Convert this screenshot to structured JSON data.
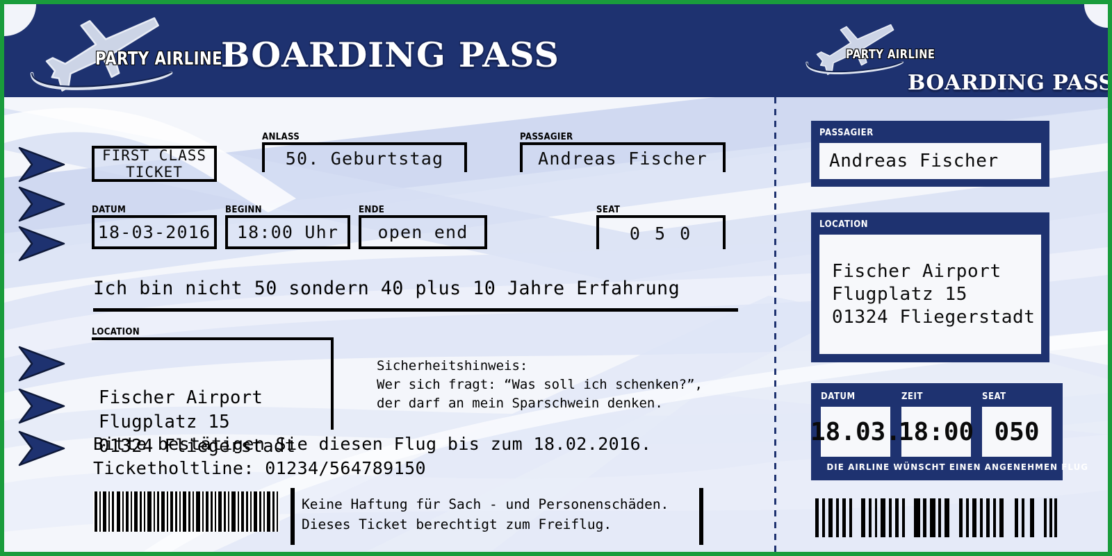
{
  "brand": {
    "airline_name": "PARTY AIRLINE",
    "title": "BOARDING PASS",
    "plane_icon": "airplane-icon",
    "header_color": "#1e3270",
    "border_color": "#1a9c3c"
  },
  "main": {
    "class_box": "FIRST CLASS\nTICKET",
    "anlass": {
      "label": "ANLASS",
      "value": "50. Geburtstag"
    },
    "passagier": {
      "label": "PASSAGIER",
      "value": "Andreas Fischer"
    },
    "datum": {
      "label": "DATUM",
      "value": "18-03-2016"
    },
    "beginn": {
      "label": "BEGINN",
      "value": "18:00 Uhr"
    },
    "ende": {
      "label": "ENDE",
      "value": "open end"
    },
    "seat": {
      "label": "SEAT",
      "value": "0 5 0"
    },
    "slogan": "Ich bin nicht 50 sondern 40 plus 10 Jahre Erfahrung",
    "location": {
      "label": "LOCATION",
      "value": "Fischer Airport\nFlugplatz 15\n01324 Fliegerstadt"
    },
    "security_note": "Sicherheitshinweis:\nWer sich fragt: “Was soll ich schenken?”,\nder darf an mein Sparschwein denken.",
    "confirm_text": "Bitte bestätigen Sie diesen Flug bis zum 18.02.2016.\nTicketholtline: 01234/564789150",
    "disclaimer": "Keine Haftung für Sach - und Personenschäden.\nDieses Ticket berechtigt zum Freiflug.",
    "barcode": "barcode-icon"
  },
  "stub": {
    "passagier": {
      "label": "PASSAGIER",
      "value": "Andreas Fischer"
    },
    "location": {
      "label": "LOCATION",
      "value": "Fischer Airport\nFlugplatz 15\n01324 Fliegerstadt"
    },
    "trio": [
      {
        "label": "DATUM",
        "value": "18.03."
      },
      {
        "label": "ZEIT",
        "value": "18:00"
      },
      {
        "label": "SEAT",
        "value": "050"
      }
    ],
    "footer": "DIE AIRLINE WÜNSCHT EINEN ANGENEHMEN FLUG",
    "barcode": "barcode-icon"
  }
}
